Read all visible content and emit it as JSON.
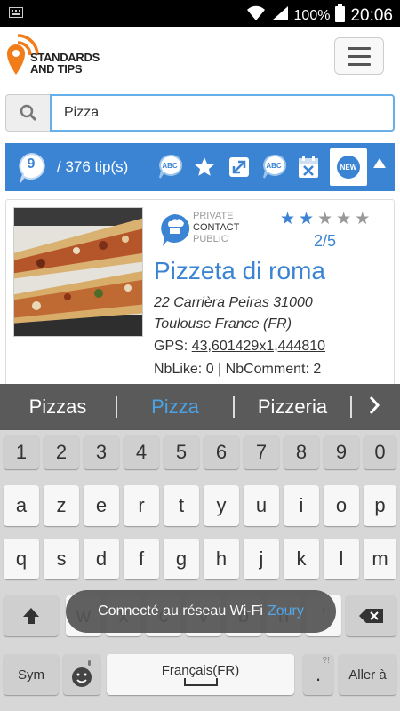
{
  "status_bar": {
    "left_icon": "keyboard-icon",
    "battery": "100%",
    "time": "20:06"
  },
  "app": {
    "logo_line1": "STANDARDS",
    "logo_line2": "AND TIPS"
  },
  "search": {
    "value": "Pizza"
  },
  "toolbar": {
    "count": "9",
    "total": "/ 376 tip(s)",
    "new_label": "NEW",
    "abc_label": "ABC"
  },
  "result": {
    "visibility_options": [
      "PRIVATE",
      "CONTACT",
      "PUBLIC"
    ],
    "selected_visibility": "CONTACT",
    "rating_stars": 2,
    "rating_max": 5,
    "rating_text": "2/5",
    "title": "Pizzeta di roma",
    "address_line1": "22 Carrièra Peiras 31000",
    "address_line2": "Toulouse France (FR)",
    "gps_label": "GPS: ",
    "gps_value": "43,601429x1,444810",
    "stats": "NbLike: 0 | NbComment: 2"
  },
  "suggestions": [
    "Pizzas",
    "Pizza",
    "Pizzeria"
  ],
  "suggestion_active_index": 1,
  "keyboard": {
    "row_numbers": [
      "1",
      "2",
      "3",
      "4",
      "5",
      "6",
      "7",
      "8",
      "9",
      "0"
    ],
    "row1": [
      "a",
      "z",
      "e",
      "r",
      "t",
      "y",
      "u",
      "i",
      "o",
      "p"
    ],
    "row2": [
      "q",
      "s",
      "d",
      "f",
      "g",
      "h",
      "j",
      "k",
      "l",
      "m"
    ],
    "row3": [
      "w",
      "x",
      "c",
      "v",
      "b",
      "n",
      "'"
    ],
    "sym_label": "Sym",
    "space_label": "Français(FR)",
    "period_label": ".",
    "enter_label": "Aller à"
  },
  "toast": {
    "text": "Connecté au réseau Wi-Fi",
    "network": "Zoury"
  },
  "colors": {
    "accent": "#3b84d4",
    "star_on": "#3b84d4",
    "star_off": "#999999"
  }
}
